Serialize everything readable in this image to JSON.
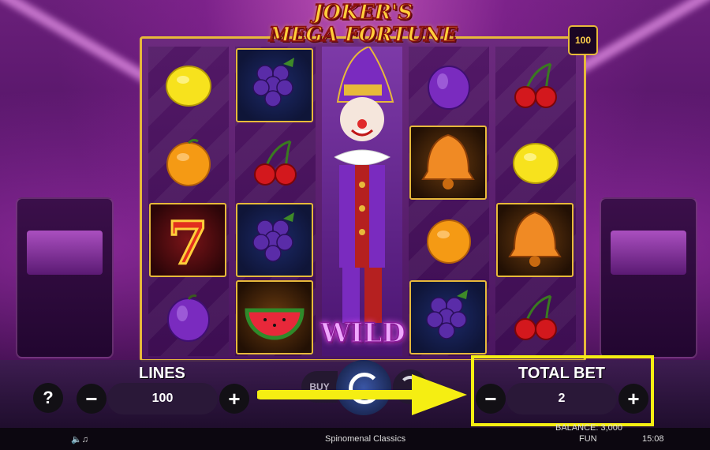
{
  "game": {
    "title_line1": "JOKER'S",
    "title_line2": "MEGA FORTUNE",
    "lines_badge": "100",
    "wild_label": "WILD"
  },
  "reels": [
    [
      "lemon-symbol",
      "orange-symbol",
      "seven-symbol",
      "plum-symbol"
    ],
    [
      "grapes-symbol",
      "cherries-symbol",
      "grapes-symbol",
      "watermelon-symbol"
    ],
    [
      "joker-wild-symbol"
    ],
    [
      "plum-symbol",
      "bell-symbol",
      "orange-symbol",
      "grapes-symbol"
    ],
    [
      "cherries-symbol",
      "lemon-symbol",
      "bell-symbol",
      "cherries-symbol"
    ]
  ],
  "controls": {
    "help_label": "?",
    "lines_label": "LINES",
    "lines_value": "100",
    "minus": "−",
    "plus": "+",
    "buy_label": "BUY",
    "total_bet_label": "TOTAL BET",
    "total_bet_value": "2"
  },
  "footer": {
    "balance_label": "BALANCE: 3,000",
    "brand": "Spinomenal Classics",
    "mode": "FUN",
    "time": "15:08"
  },
  "colors": {
    "accent_gold": "#e7b93a",
    "highlight_yellow": "#f5ee12"
  }
}
